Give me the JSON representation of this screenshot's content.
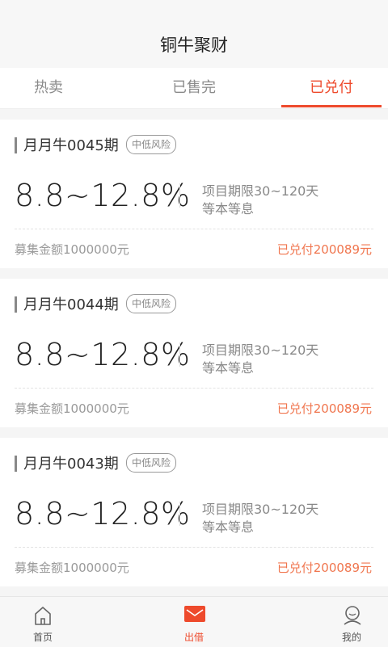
{
  "header": {
    "title": "铜牛聚财"
  },
  "tabs": [
    {
      "label": "热卖"
    },
    {
      "label": "已售完"
    },
    {
      "label": "已兑付",
      "active": true
    }
  ],
  "products": [
    {
      "name": "月月牛0045期",
      "risk": "中低风险",
      "rate": "8.8~12.8%",
      "term": "项目期限30~120天",
      "repayment": "等本等息",
      "amount": "募集金额1000000元",
      "paid": "已兑付200089元"
    },
    {
      "name": "月月牛0044期",
      "risk": "中低风险",
      "rate": "8.8~12.8%",
      "term": "项目期限30~120天",
      "repayment": "等本等息",
      "amount": "募集金额1000000元",
      "paid": "已兑付200089元"
    },
    {
      "name": "月月牛0043期",
      "risk": "中低风险",
      "rate": "8.8~12.8%",
      "term": "项目期限30~120天",
      "repayment": "等本等息",
      "amount": "募集金额1000000元",
      "paid": "已兑付200089元"
    }
  ],
  "bottom_nav": [
    {
      "label": "首页",
      "icon": "home-icon"
    },
    {
      "label": "出借",
      "icon": "lend-icon",
      "active": true
    },
    {
      "label": "我的",
      "icon": "profile-icon"
    }
  ],
  "colors": {
    "accent": "#ee4a2c",
    "paid_text": "#f0764f"
  }
}
